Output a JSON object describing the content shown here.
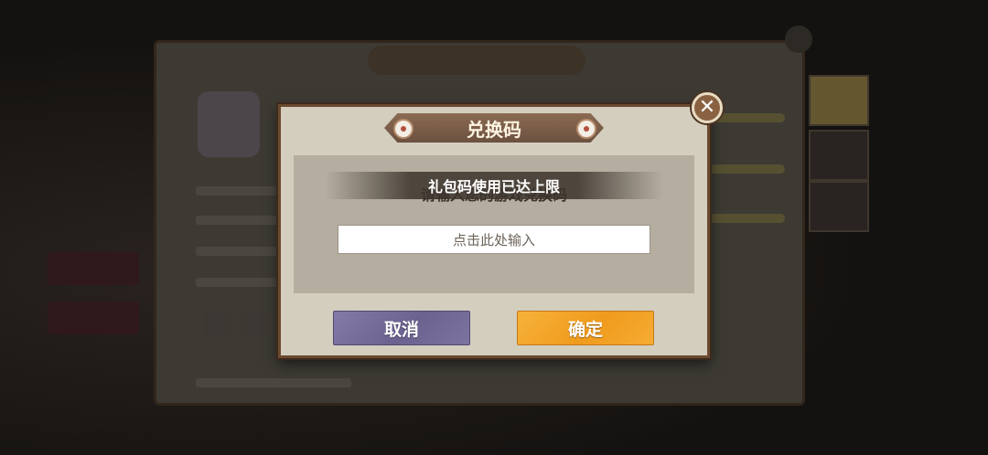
{
  "dialog": {
    "title": "兑换码",
    "prompt": "请输入您的游戏兑换码",
    "toast": "礼包码使用已达上限",
    "input_placeholder": "点击此处输入",
    "cancel_label": "取消",
    "confirm_label": "确定",
    "close_symbol": "✕"
  },
  "colors": {
    "dialog_bg": "#d4cebf",
    "dialog_border": "#6b4a30",
    "cancel_button": "#7a70a0",
    "confirm_button": "#f2a126"
  },
  "icons": [
    "close-icon",
    "ribbon-ornament-icon"
  ]
}
